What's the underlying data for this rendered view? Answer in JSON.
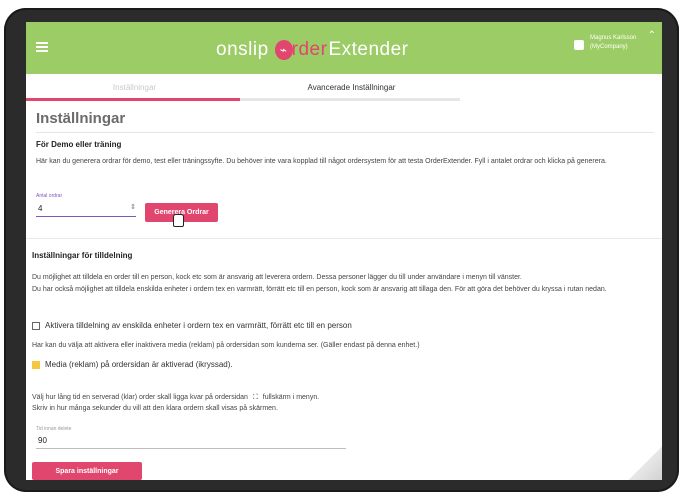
{
  "header": {
    "brand_left": "onslip",
    "brand_order": "rder",
    "brand_extender": "Extender",
    "user_name": "Magnus Karlsson",
    "user_company": "(MyCompany)"
  },
  "tabs": [
    {
      "label": "Inställningar",
      "active": false
    },
    {
      "label": "Avancerade Inställningar",
      "active": true
    }
  ],
  "page": {
    "title": "Inställningar"
  },
  "demo_section": {
    "title": "För Demo eller träning",
    "text": "Här kan du generera ordrar för demo, test eller träningssyfte. Du behöver inte vara kopplad till något ordersystem för att testa OrderExtender. Fyll i antalet ordrar och klicka på generera.",
    "orders_label": "Antal ordrar",
    "orders_value": "4",
    "generate_button": "Generera Ordrar"
  },
  "assignment_section": {
    "title": "Inställningar för tilldelning",
    "text": "Du möjlighet att tilldela en order till en person, kock etc som är ansvarig att leverera ordern. Dessa personer lägger du till under användare i menyn till vänster.\nDu har också möjlighet att tilldela enskilda enheter i ordern tex en varmrätt, förrätt etc till en person, kock som är ansvarig att tillaga den. För att göra det behöver du kryssa i rutan nedan.",
    "checkbox1_label": "Aktivera tilldelning av enskilda enheter i ordern tex en varmrätt, förrätt etc till en person",
    "media_text": "Har kan du välja att aktivera eller inaktivera media (reklam) på ordersidan som kunderna ser. (Gäller endast på denna enhet.)",
    "checkbox2_label": "Media (reklam) på ordersidan är aktiverad (ikryssad).",
    "time_text_part1": "Välj hur lång tid en serverad (klar) order skall ligga kvar på ordersidan",
    "time_text_part2": "fullskärm i menyn.",
    "time_text_line2": "Skriv in hur många sekunder du vill att den klara ordern skall visas på skärmen.",
    "delete_label": "Tid innan delete",
    "delete_value": "90",
    "save_button": "Spara inställningar"
  },
  "colors": {
    "header_green": "#9ccc65",
    "accent_pink": "#e0466e",
    "accent_purple": "#7e57c2",
    "checkbox_yellow": "#f5c842"
  }
}
